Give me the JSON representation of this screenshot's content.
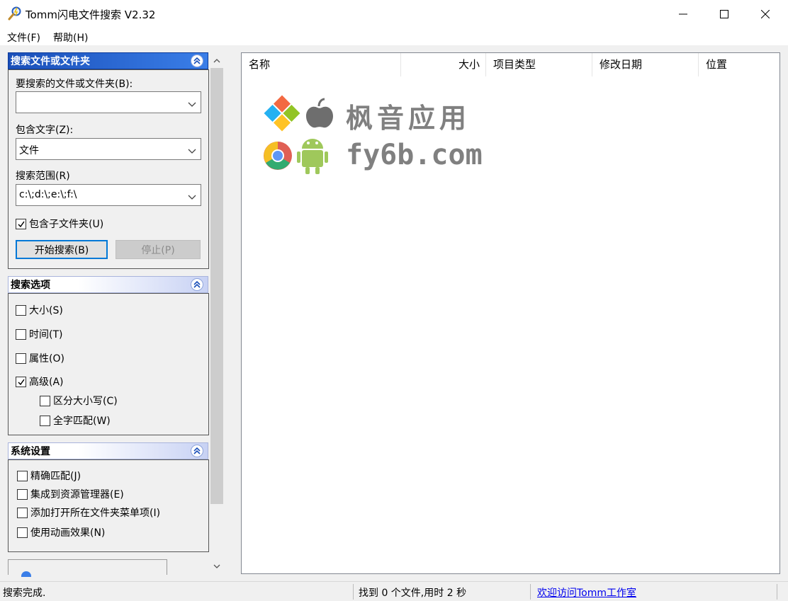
{
  "window": {
    "title": "Tomm闪电文件搜索 V2.32"
  },
  "menu": {
    "file": "文件(F)",
    "help": "帮助(H)"
  },
  "search_panel": {
    "header": "搜索文件或文件夹",
    "file_label": "要搜索的文件或文件夹(B):",
    "file_value": "",
    "text_label": "包含文字(Z):",
    "text_value": "文件",
    "scope_label": "搜索范围(R)",
    "scope_value": "c:\\;d:\\;e:\\;f:\\",
    "subfolders_label": "包含子文件夹(U)",
    "subfolders_checked": true,
    "start_button": "开始搜索(B)",
    "stop_button": "停止(P)"
  },
  "options_panel": {
    "header": "搜索选项",
    "size": "大小(S)",
    "time": "时间(T)",
    "attribute": "属性(O)",
    "advanced": "高级(A)",
    "advanced_checked": true,
    "case_sensitive": "区分大小写(C)",
    "whole_word": "全字匹配(W)"
  },
  "settings_panel": {
    "header": "系统设置",
    "exact_match": "精确匹配(J)",
    "integrate_explorer": "集成到资源管理器(E)",
    "add_open_folder_menu": "添加打开所在文件夹菜单项(I)",
    "use_animation": "使用动画效果(N)"
  },
  "results": {
    "columns": [
      "名称",
      "大小",
      "项目类型",
      "修改日期",
      "位置"
    ]
  },
  "watermark": {
    "cn": "枫音应用",
    "domain": "fy6b.com"
  },
  "status": {
    "left": "搜索完成.",
    "middle": "找到 0 个文件,用时 2 秒",
    "link": "欢迎访问Tomm工作室"
  },
  "colors": {
    "active_header": "#1a4fb9",
    "focus_border": "#0078d7",
    "link": "#0000ee"
  }
}
